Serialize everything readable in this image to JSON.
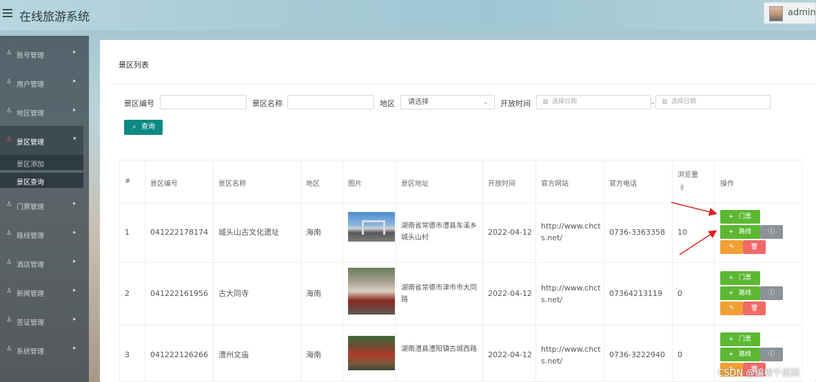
{
  "app": {
    "title": "在线旅游系统",
    "user": "admin"
  },
  "sidebar": {
    "items": [
      {
        "label": "账号管理"
      },
      {
        "label": "用户管理"
      },
      {
        "label": "地区管理"
      },
      {
        "label": "景区管理",
        "children": [
          "景区添加",
          "景区查询"
        ]
      },
      {
        "label": "门票管理"
      },
      {
        "label": "路线管理"
      },
      {
        "label": "酒店管理"
      },
      {
        "label": "新闻管理"
      },
      {
        "label": "签证管理"
      },
      {
        "label": "系统管理"
      }
    ]
  },
  "panel": {
    "title": "景区列表"
  },
  "search": {
    "code_label": "景区编号",
    "name_label": "景区名称",
    "region_label": "地区",
    "region_value": "请选择",
    "open_time_label": "开放时间",
    "date_placeholder_start": "选择日期",
    "date_placeholder_end": "选择日期",
    "date_separator": "-",
    "query_button": "查询"
  },
  "table": {
    "columns": [
      "#",
      "景区编号",
      "景区名称",
      "地区",
      "图片",
      "景区地址",
      "开放时间",
      "官方网站",
      "官方电话",
      "浏览量",
      "操作"
    ],
    "rows": [
      {
        "index": "1",
        "code": "041222178174",
        "name": "城头山古文化遗址",
        "region": "海南",
        "address": "湖南省常德市澧县车溪乡城头山村",
        "open_time": "2022-04-12",
        "website": "http://www.chcts.net/",
        "phone": "0736-3363358",
        "views": "10"
      },
      {
        "index": "2",
        "code": "041222161956",
        "name": "古大同寺",
        "region": "海南",
        "address": "湖南省常德市津市市大同路",
        "open_time": "2022-04-12",
        "website": "http://www.chcts.net/",
        "phone": "07364213119",
        "views": "0"
      },
      {
        "index": "3",
        "code": "041222126266",
        "name": "澧州文庙",
        "region": "海南",
        "address": "湖南澧县澧阳镇古城西路",
        "open_time": "2022-04-12",
        "website": "http://www.chcts.net/",
        "phone": "0736-3222940",
        "views": "0"
      }
    ],
    "actions": {
      "ticket": "门票",
      "route": "路线"
    }
  },
  "watermark": "CSDN @编程千纸鹤",
  "colors": {
    "primary": "#0b8a84",
    "green": "#5cb832",
    "orange": "#f0a034",
    "red": "#f06a68",
    "gray": "#8c9398",
    "arrow": "#e02020"
  },
  "icons": [
    "menu-icon",
    "user-icon",
    "chevron-right-icon",
    "chevron-down-icon",
    "search-icon",
    "calendar-icon",
    "plus-icon",
    "info-icon",
    "edit-icon",
    "delete-icon",
    "sort-icon"
  ]
}
